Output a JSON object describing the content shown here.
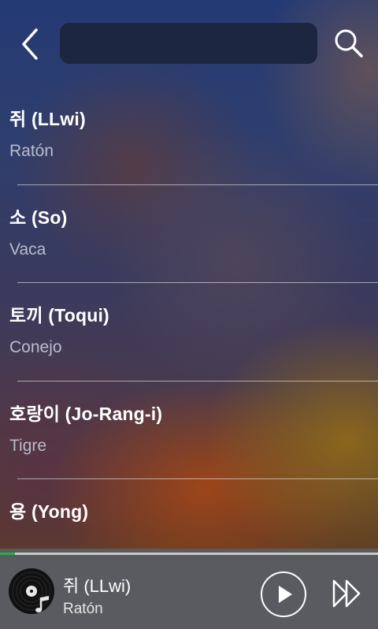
{
  "search": {
    "value": "",
    "placeholder": ""
  },
  "icons": {
    "back": "chevron-left-icon",
    "search": "magnifier-icon",
    "disc": "vinyl-record-music-note-icon",
    "play": "play-icon",
    "fast_forward": "fast-forward-icon"
  },
  "items": [
    {
      "title": "쥐 (LLwi)",
      "subtitle": "Ratón"
    },
    {
      "title": "소 (So)",
      "subtitle": "Vaca"
    },
    {
      "title": "토끼 (Toqui)",
      "subtitle": "Conejo"
    },
    {
      "title": "호랑이 (Jo-Rang-i)",
      "subtitle": "Tigre"
    },
    {
      "title": "용 (Yong)",
      "subtitle": ""
    }
  ],
  "player": {
    "title": "쥐 (LLwi)",
    "subtitle": "Ratón",
    "progress": 0.04,
    "progress_color": "#2eaa46"
  }
}
